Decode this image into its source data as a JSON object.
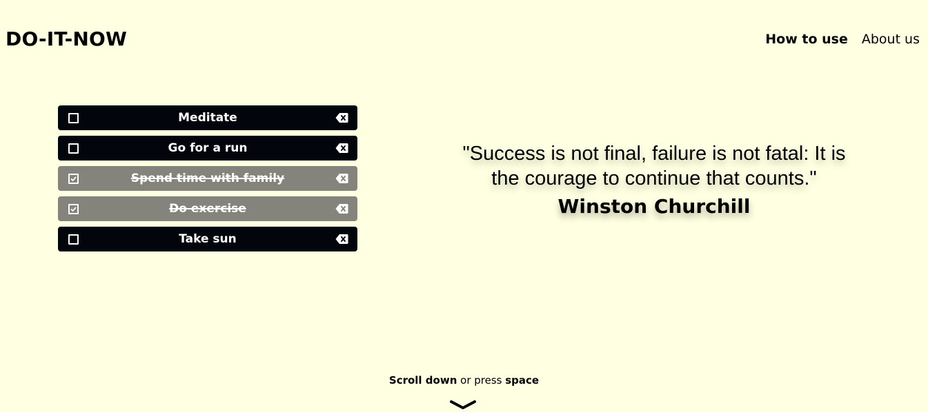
{
  "header": {
    "brand": "DO-IT-NOW",
    "nav": [
      {
        "label": "How to use",
        "active": true
      },
      {
        "label": "About us",
        "active": false
      }
    ]
  },
  "todos": [
    {
      "label": "Meditate",
      "done": false
    },
    {
      "label": "Go for a run",
      "done": false
    },
    {
      "label": "Spend time with family",
      "done": true
    },
    {
      "label": "Do exercise",
      "done": true
    },
    {
      "label": "Take sun",
      "done": false
    }
  ],
  "quote": {
    "text": "\"Success is not final, failure is not fatal: It is the courage to continue that counts.\"",
    "author": "Winston Churchill"
  },
  "scroll_hint": {
    "part1": "Scroll down",
    "part2": " or press ",
    "part3": "space"
  },
  "icons": {
    "checkbox": "checkbox-icon",
    "delete": "backspace-delete-icon",
    "scroll": "chevron-down-icon"
  },
  "colors": {
    "background": "#ffffe2",
    "todo_active": "#02060c",
    "todo_done": "#84847d"
  }
}
